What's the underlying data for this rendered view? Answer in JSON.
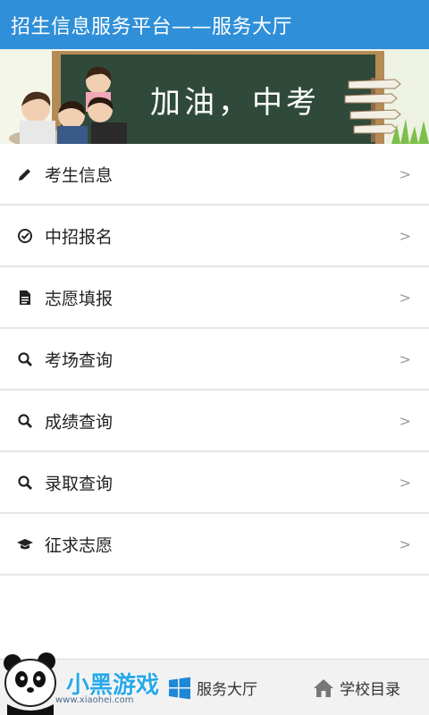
{
  "header": {
    "title": "招生信息服务平台——服务大厅"
  },
  "banner": {
    "slogan": "加油，中考"
  },
  "menu": {
    "items": [
      {
        "label": "考生信息",
        "icon": "pencil-icon",
        "chevron": ">"
      },
      {
        "label": "中招报名",
        "icon": "check-circle-icon",
        "chevron": ">"
      },
      {
        "label": "志愿填报",
        "icon": "document-icon",
        "chevron": ">"
      },
      {
        "label": "考场查询",
        "icon": "search-icon",
        "chevron": ">"
      },
      {
        "label": "成绩查询",
        "icon": "search-icon",
        "chevron": ">"
      },
      {
        "label": "录取查询",
        "icon": "search-icon",
        "chevron": ">"
      },
      {
        "label": "征求志愿",
        "icon": "graduation-cap-icon",
        "chevron": ">"
      }
    ]
  },
  "bottom_nav": {
    "tabs": [
      {
        "label": "服务大厅",
        "icon": "windows-icon"
      },
      {
        "label": "学校目录",
        "icon": "home-icon"
      }
    ]
  },
  "watermark": {
    "brand": "小黑游戏",
    "url": "www.xiaohei.com"
  },
  "colors": {
    "header_bg": "#2f8fd8",
    "accent": "#1e88d8",
    "chalkboard": "#2f4a3a"
  }
}
